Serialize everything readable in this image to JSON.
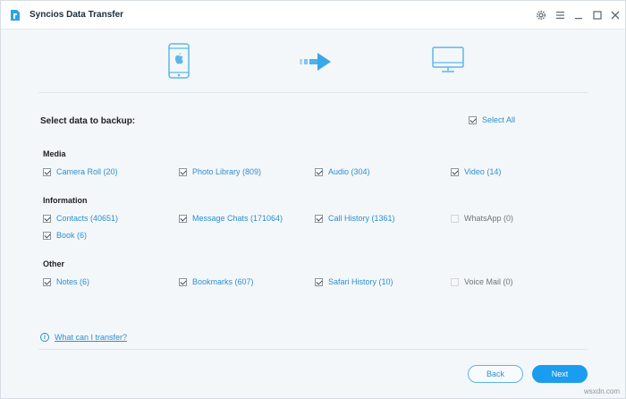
{
  "app": {
    "title": "Syncios Data Transfer"
  },
  "window_controls": [
    "settings-icon",
    "menu-icon",
    "minimize-icon",
    "maximize-icon",
    "close-icon"
  ],
  "select": {
    "title": "Select data to backup:",
    "select_all_label": "Select All",
    "select_all_checked": true
  },
  "sections": {
    "media": {
      "title": "Media",
      "items": [
        {
          "label": "Camera Roll (20)",
          "checked": true,
          "enabled": true
        },
        {
          "label": "Photo Library (809)",
          "checked": true,
          "enabled": true
        },
        {
          "label": "Audio (304)",
          "checked": true,
          "enabled": true
        },
        {
          "label": "Video (14)",
          "checked": true,
          "enabled": true
        }
      ]
    },
    "information": {
      "title": "Information",
      "items": [
        {
          "label": "Contacts (40651)",
          "checked": true,
          "enabled": true
        },
        {
          "label": "Message Chats (171064)",
          "checked": true,
          "enabled": true
        },
        {
          "label": "Call History (1361)",
          "checked": true,
          "enabled": true
        },
        {
          "label": "WhatsApp (0)",
          "checked": false,
          "enabled": false
        },
        {
          "label": "Book (6)",
          "checked": true,
          "enabled": true
        }
      ]
    },
    "other": {
      "title": "Other",
      "items": [
        {
          "label": "Notes (6)",
          "checked": true,
          "enabled": true
        },
        {
          "label": "Bookmarks (607)",
          "checked": true,
          "enabled": true
        },
        {
          "label": "Safari History (10)",
          "checked": true,
          "enabled": true
        },
        {
          "label": "Voice Mail (0)",
          "checked": false,
          "enabled": false
        }
      ]
    }
  },
  "help": {
    "label": "What can I transfer?"
  },
  "buttons": {
    "back": "Back",
    "next": "Next"
  },
  "watermark": "wsxdn.com",
  "colors": {
    "accent": "#1a9cf0",
    "link": "#2c8fd0",
    "icon": "#5ab8e8"
  }
}
